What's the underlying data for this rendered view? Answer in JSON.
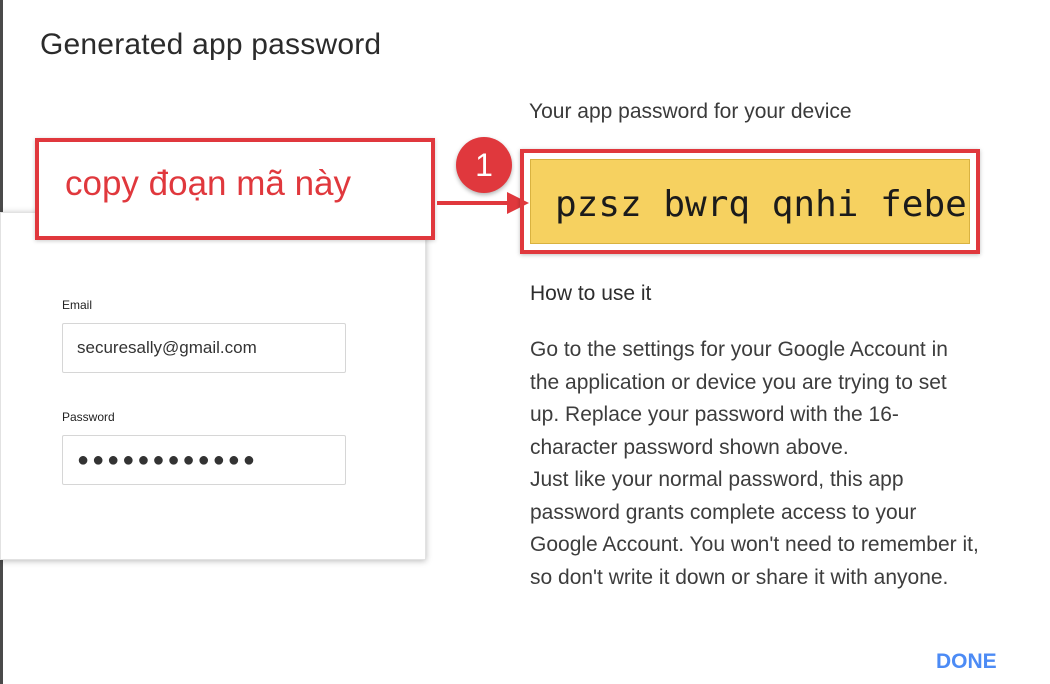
{
  "dialog": {
    "title": "Generated app password",
    "done_label": "DONE"
  },
  "device_form": {
    "email_label": "Email",
    "email_value": "securesally@gmail.com",
    "password_label": "Password",
    "password_value": "●●●●●●●●●●●●"
  },
  "annotation": {
    "text": "copy đoạn mã này",
    "step_number": "1",
    "color": "#e0383d"
  },
  "app_password": {
    "heading": "Your app password for your device",
    "value": "pzsz bwrq qnhi febe",
    "highlight_color": "#f6d160"
  },
  "how_to": {
    "heading": "How to use it",
    "lines": [
      "Go to the settings for your Google Account in",
      "the application or device you are trying to set",
      "up. Replace your password with the 16-",
      "character password shown above.",
      "Just like your normal password, this app",
      "password grants complete access to your",
      "Google Account. You won't need to remember it,",
      "so don't write it down or share it with anyone."
    ]
  },
  "colors": {
    "accent": "#4c8bf5",
    "annotation_red": "#e0383d"
  }
}
